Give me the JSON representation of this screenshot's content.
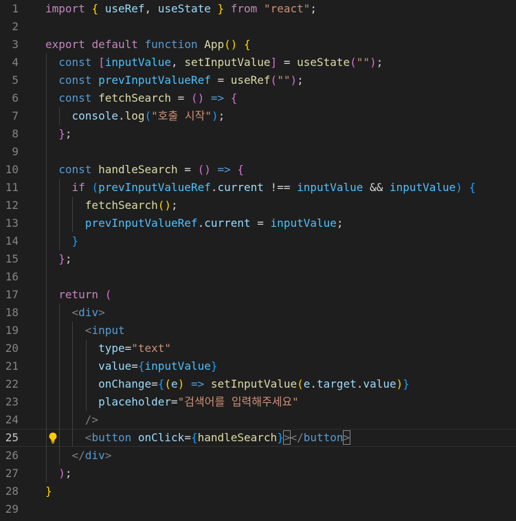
{
  "editor": {
    "lines": [
      {
        "n": 1,
        "tokens": [
          [
            "import",
            "kw-ctrl"
          ],
          [
            " ",
            "plain"
          ],
          [
            "{",
            "b1"
          ],
          [
            " ",
            "plain"
          ],
          [
            "useRef",
            "var"
          ],
          [
            ", ",
            "plain"
          ],
          [
            "useState",
            "var"
          ],
          [
            " ",
            "plain"
          ],
          [
            "}",
            "b1"
          ],
          [
            " ",
            "plain"
          ],
          [
            "from",
            "kw-ctrl"
          ],
          [
            " ",
            "plain"
          ],
          [
            "\"react\"",
            "str"
          ],
          [
            ";",
            "plain"
          ]
        ]
      },
      {
        "n": 2,
        "tokens": []
      },
      {
        "n": 3,
        "tokens": [
          [
            "export",
            "kw-ctrl"
          ],
          [
            " ",
            "plain"
          ],
          [
            "default",
            "kw-ctrl"
          ],
          [
            " ",
            "plain"
          ],
          [
            "function",
            "kw"
          ],
          [
            " ",
            "plain"
          ],
          [
            "App",
            "fn"
          ],
          [
            "()",
            "b1"
          ],
          [
            " ",
            "plain"
          ],
          [
            "{",
            "b1"
          ]
        ]
      },
      {
        "n": 4,
        "tokens": [
          [
            "  ",
            "plain"
          ],
          [
            "const",
            "kw"
          ],
          [
            " ",
            "plain"
          ],
          [
            "[",
            "b2"
          ],
          [
            "inputValue",
            "const"
          ],
          [
            ", ",
            "plain"
          ],
          [
            "setInputValue",
            "fn"
          ],
          [
            "]",
            "b2"
          ],
          [
            " = ",
            "plain"
          ],
          [
            "useState",
            "fn"
          ],
          [
            "(",
            "b2"
          ],
          [
            "\"\"",
            "str"
          ],
          [
            ")",
            "b2"
          ],
          [
            ";",
            "plain"
          ]
        ]
      },
      {
        "n": 5,
        "tokens": [
          [
            "  ",
            "plain"
          ],
          [
            "const",
            "kw"
          ],
          [
            " ",
            "plain"
          ],
          [
            "prevInputValueRef",
            "const"
          ],
          [
            " = ",
            "plain"
          ],
          [
            "useRef",
            "fn"
          ],
          [
            "(",
            "b2"
          ],
          [
            "\"\"",
            "str"
          ],
          [
            ")",
            "b2"
          ],
          [
            ";",
            "plain"
          ]
        ]
      },
      {
        "n": 6,
        "tokens": [
          [
            "  ",
            "plain"
          ],
          [
            "const",
            "kw"
          ],
          [
            " ",
            "plain"
          ],
          [
            "fetchSearch",
            "fn"
          ],
          [
            " = ",
            "plain"
          ],
          [
            "()",
            "b2"
          ],
          [
            " ",
            "plain"
          ],
          [
            "=>",
            "kw"
          ],
          [
            " ",
            "plain"
          ],
          [
            "{",
            "b2"
          ]
        ]
      },
      {
        "n": 7,
        "tokens": [
          [
            "    ",
            "plain"
          ],
          [
            "console",
            "var"
          ],
          [
            ".",
            "plain"
          ],
          [
            "log",
            "fn"
          ],
          [
            "(",
            "b3"
          ],
          [
            "\"호출 시작\"",
            "str"
          ],
          [
            ")",
            "b3"
          ],
          [
            ";",
            "plain"
          ]
        ]
      },
      {
        "n": 8,
        "tokens": [
          [
            "  ",
            "plain"
          ],
          [
            "}",
            "b2"
          ],
          [
            ";",
            "plain"
          ]
        ]
      },
      {
        "n": 9,
        "tokens": []
      },
      {
        "n": 10,
        "tokens": [
          [
            "  ",
            "plain"
          ],
          [
            "const",
            "kw"
          ],
          [
            " ",
            "plain"
          ],
          [
            "handleSearch",
            "fn"
          ],
          [
            " = ",
            "plain"
          ],
          [
            "()",
            "b2"
          ],
          [
            " ",
            "plain"
          ],
          [
            "=>",
            "kw"
          ],
          [
            " ",
            "plain"
          ],
          [
            "{",
            "b2"
          ]
        ]
      },
      {
        "n": 11,
        "tokens": [
          [
            "    ",
            "plain"
          ],
          [
            "if",
            "kw-ctrl"
          ],
          [
            " ",
            "plain"
          ],
          [
            "(",
            "b3"
          ],
          [
            "prevInputValueRef",
            "const"
          ],
          [
            ".",
            "plain"
          ],
          [
            "current",
            "var"
          ],
          [
            " !== ",
            "plain"
          ],
          [
            "inputValue",
            "const"
          ],
          [
            " && ",
            "plain"
          ],
          [
            "inputValue",
            "const"
          ],
          [
            ")",
            "b3"
          ],
          [
            " ",
            "plain"
          ],
          [
            "{",
            "b3"
          ]
        ]
      },
      {
        "n": 12,
        "tokens": [
          [
            "      ",
            "plain"
          ],
          [
            "fetchSearch",
            "fn"
          ],
          [
            "()",
            "b1"
          ],
          [
            ";",
            "plain"
          ]
        ]
      },
      {
        "n": 13,
        "tokens": [
          [
            "      ",
            "plain"
          ],
          [
            "prevInputValueRef",
            "const"
          ],
          [
            ".",
            "plain"
          ],
          [
            "current",
            "var"
          ],
          [
            " = ",
            "plain"
          ],
          [
            "inputValue",
            "const"
          ],
          [
            ";",
            "plain"
          ]
        ]
      },
      {
        "n": 14,
        "tokens": [
          [
            "    ",
            "plain"
          ],
          [
            "}",
            "b3"
          ]
        ]
      },
      {
        "n": 15,
        "tokens": [
          [
            "  ",
            "plain"
          ],
          [
            "}",
            "b2"
          ],
          [
            ";",
            "plain"
          ]
        ]
      },
      {
        "n": 16,
        "tokens": []
      },
      {
        "n": 17,
        "tokens": [
          [
            "  ",
            "plain"
          ],
          [
            "return",
            "kw-ctrl"
          ],
          [
            " ",
            "plain"
          ],
          [
            "(",
            "b2"
          ]
        ]
      },
      {
        "n": 18,
        "tokens": [
          [
            "    ",
            "plain"
          ],
          [
            "<",
            "tagp"
          ],
          [
            "div",
            "tag"
          ],
          [
            ">",
            "tagp"
          ]
        ]
      },
      {
        "n": 19,
        "tokens": [
          [
            "      ",
            "plain"
          ],
          [
            "<",
            "tagp"
          ],
          [
            "input",
            "tag"
          ]
        ]
      },
      {
        "n": 20,
        "tokens": [
          [
            "        ",
            "plain"
          ],
          [
            "type",
            "attr"
          ],
          [
            "=",
            "plain"
          ],
          [
            "\"text\"",
            "str"
          ]
        ]
      },
      {
        "n": 21,
        "tokens": [
          [
            "        ",
            "plain"
          ],
          [
            "value",
            "attr"
          ],
          [
            "=",
            "plain"
          ],
          [
            "{",
            "b3"
          ],
          [
            "inputValue",
            "const"
          ],
          [
            "}",
            "b3"
          ]
        ]
      },
      {
        "n": 22,
        "tokens": [
          [
            "        ",
            "plain"
          ],
          [
            "onChange",
            "attr"
          ],
          [
            "=",
            "plain"
          ],
          [
            "{",
            "b3"
          ],
          [
            "(",
            "b1"
          ],
          [
            "e",
            "var"
          ],
          [
            ")",
            "b1"
          ],
          [
            " ",
            "plain"
          ],
          [
            "=>",
            "kw"
          ],
          [
            " ",
            "plain"
          ],
          [
            "setInputValue",
            "fn"
          ],
          [
            "(",
            "b1"
          ],
          [
            "e",
            "var"
          ],
          [
            ".",
            "plain"
          ],
          [
            "target",
            "var"
          ],
          [
            ".",
            "plain"
          ],
          [
            "value",
            "var"
          ],
          [
            ")",
            "b1"
          ],
          [
            "}",
            "b3"
          ]
        ]
      },
      {
        "n": 23,
        "tokens": [
          [
            "        ",
            "plain"
          ],
          [
            "placeholder",
            "attr"
          ],
          [
            "=",
            "plain"
          ],
          [
            "\"검색어를 입력해주세요\"",
            "str"
          ]
        ]
      },
      {
        "n": 24,
        "tokens": [
          [
            "      ",
            "plain"
          ],
          [
            "/>",
            "tagp"
          ]
        ]
      },
      {
        "n": 25,
        "tokens": [
          [
            "      ",
            "plain"
          ],
          [
            "<",
            "tagp"
          ],
          [
            "button",
            "tag"
          ],
          [
            " ",
            "plain"
          ],
          [
            "onClick",
            "attr"
          ],
          [
            "=",
            "plain"
          ],
          [
            "{",
            "b3"
          ],
          [
            "handleSearch",
            "fn"
          ],
          [
            "}",
            "b3"
          ],
          [
            ">",
            "tagp"
          ],
          [
            "</",
            "tagp"
          ],
          [
            "button",
            "tag"
          ],
          [
            ">",
            "tagp"
          ]
        ]
      },
      {
        "n": 26,
        "tokens": [
          [
            "    ",
            "plain"
          ],
          [
            "</",
            "tagp"
          ],
          [
            "div",
            "tag"
          ],
          [
            ">",
            "tagp"
          ]
        ]
      },
      {
        "n": 27,
        "tokens": [
          [
            "  ",
            "plain"
          ],
          [
            ")",
            "b2"
          ],
          [
            ";",
            "plain"
          ]
        ]
      },
      {
        "n": 28,
        "tokens": [
          [
            "}",
            "b1"
          ]
        ]
      },
      {
        "n": 29,
        "tokens": []
      }
    ],
    "current_line": 25,
    "lightbulb_icon": "lightbulb-icon"
  }
}
